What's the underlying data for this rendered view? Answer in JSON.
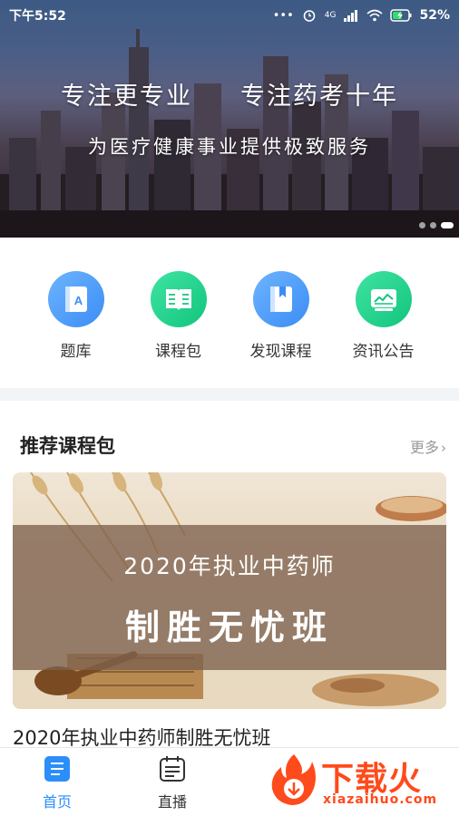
{
  "status_bar": {
    "time": "下午5:52",
    "network": "4G",
    "battery": "52%"
  },
  "banner": {
    "title": "专注更专业     专注药考十年",
    "subtitle": "为医疗健康事业提供极致服务",
    "slide_count": 3,
    "active_slide": 3
  },
  "quick_nav": [
    {
      "label": "题库",
      "icon": "question-bank-icon",
      "color": "#4a9af7"
    },
    {
      "label": "课程包",
      "icon": "open-book-icon",
      "color": "#1fcf8a"
    },
    {
      "label": "发现课程",
      "icon": "bookmark-book-icon",
      "color": "#4a9af7"
    },
    {
      "label": "资讯公告",
      "icon": "chart-board-icon",
      "color": "#1fcf8a"
    }
  ],
  "recommend": {
    "section_title": "推荐课程包",
    "more_label": "更多",
    "course": {
      "banner_line1": "2020年执业中药师",
      "banner_line2": "制胜无忧班",
      "title": "2020年执业中药师制胜无忧班"
    }
  },
  "tabbar": {
    "tabs": [
      {
        "label": "首页",
        "icon": "home-list-icon",
        "active": true
      },
      {
        "label": "直播",
        "icon": "calendar-list-icon",
        "active": false
      }
    ],
    "accent": "#2c8ef8"
  },
  "watermark": {
    "text": "下载火",
    "url": "xiazaihuo.com"
  }
}
